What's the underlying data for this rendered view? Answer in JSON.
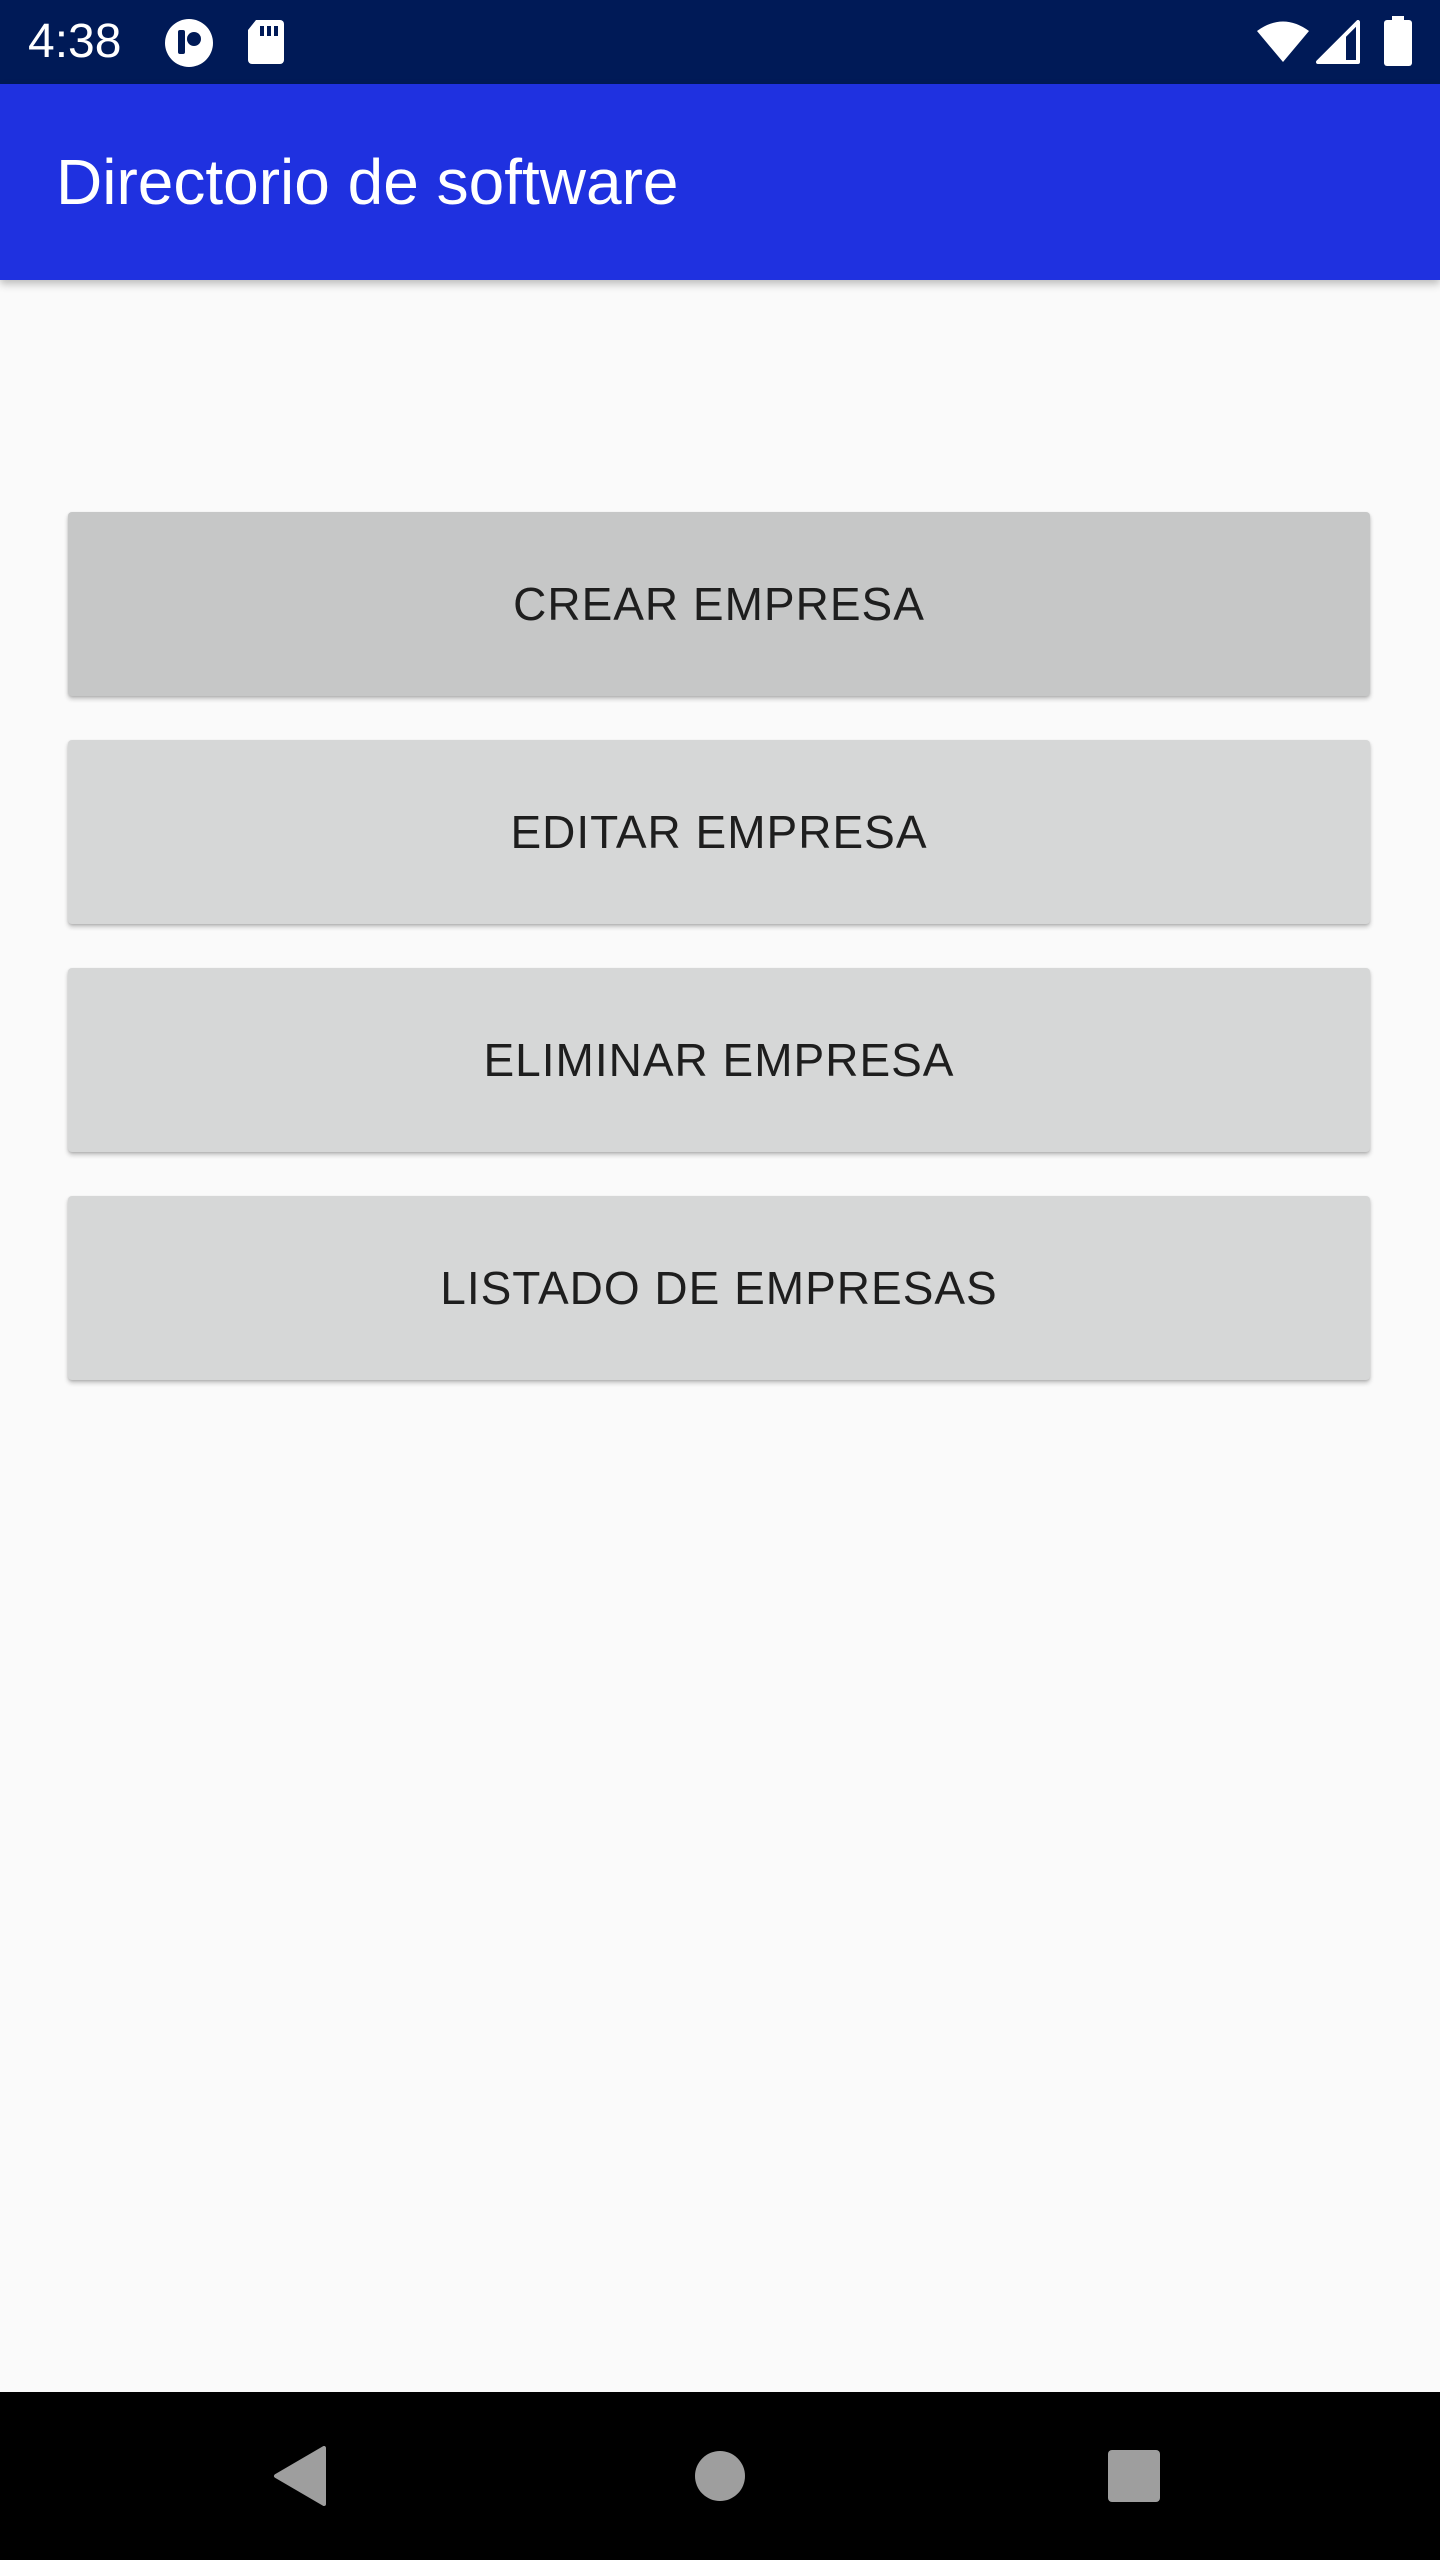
{
  "status_bar": {
    "time": "4:38",
    "icons": [
      "app-badge-icon",
      "sd-card-icon",
      "wifi-icon",
      "cell-signal-icon",
      "battery-icon"
    ],
    "background": "#001a57"
  },
  "app_bar": {
    "title": "Directorio de software",
    "background": "#1f31e0"
  },
  "actions": {
    "crear": "CREAR EMPRESA",
    "editar": "EDITAR EMPRESA",
    "eliminar": "ELIMINAR EMPRESA",
    "listado": "LISTADO DE EMPRESAS",
    "button_color": "#d6d7d7",
    "pressed_button_color": "#c6c7c7"
  },
  "nav_bar": {
    "icons": [
      "back-icon",
      "home-icon",
      "recents-icon"
    ],
    "background": "#000000"
  }
}
